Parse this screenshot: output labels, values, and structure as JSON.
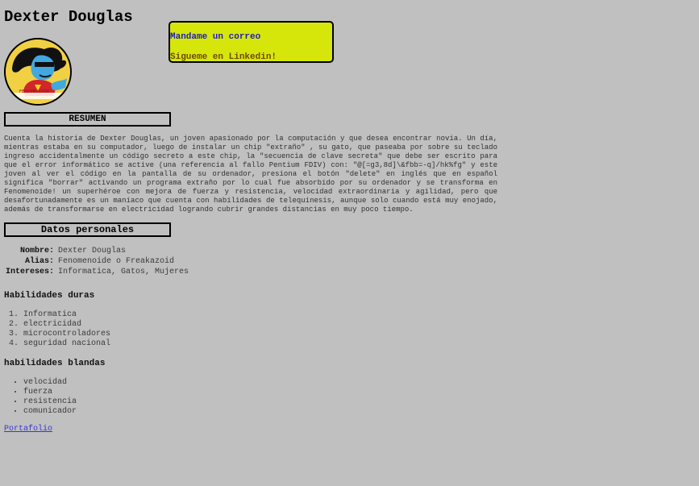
{
  "header": {
    "title": "Dexter Douglas"
  },
  "avatar": {
    "caption": "FENOMENOIDE"
  },
  "contact": {
    "email_label": "Mandame un correo",
    "linkedin_label": "Sigueme en Linkedin!"
  },
  "resumen": {
    "title": "RESUMEN",
    "text": "Cuenta la historia de Dexter Douglas, un joven apasionado por la computación y que desea encontrar novia. Un día, mientras estaba en su computador, luego de instalar un chip \"extraño\" , su gato, que paseaba por sobre su teclado ingreso accidentalmente un código secreto a este chip, la \"secuencia de clave secreta\" que debe ser escrito para que el error informático se active (una referencia al fallo Pentium FDIV) con: \"@[=g3,8d]\\&fbb=-q]/hk%fg\" y este joven al ver el código en la pantalla de su ordenador, presiona el botón \"delete\" en inglés que en español significa \"borrar\" activando un programa extraño por lo cual fue absorbido por su ordenador y se transforma en Fenomenoide! un superhéroe con mejora de fuerza y resistencia, velocidad extraordinaria y agilidad, pero que desafortunadamente es un maníaco que cuenta con habilidades de telequinesis, aunque solo cuando está muy enojado, además de transformarse en electricidad logrando cubrir grandes distancias en muy poco tiempo."
  },
  "datos": {
    "title": "Datos personales",
    "rows": [
      {
        "label": "Nombre:",
        "value": "Dexter Douglas"
      },
      {
        "label": "Alias:",
        "value": "Fenomenoide o Freakazoid"
      },
      {
        "label": "Intereses:",
        "value": "Informatica, Gatos, Mujeres"
      }
    ]
  },
  "hard_skills": {
    "title": "Habilidades duras",
    "items": [
      "Informatica",
      "electricidad",
      "microcontroladores",
      "seguridad nacional"
    ]
  },
  "soft_skills": {
    "title": "habilidades blandas",
    "items": [
      "velocidad",
      "fuerza",
      "resistencia",
      "comunicador"
    ]
  },
  "footer": {
    "portfolio_label": "Portafolio"
  },
  "colors": {
    "page_background": "#c0c0c0",
    "contact_box": "#d6e60a",
    "email_link": "#1d1dbf",
    "linkedin_link": "#6b4b00",
    "portfolio_link": "#3636d8"
  }
}
